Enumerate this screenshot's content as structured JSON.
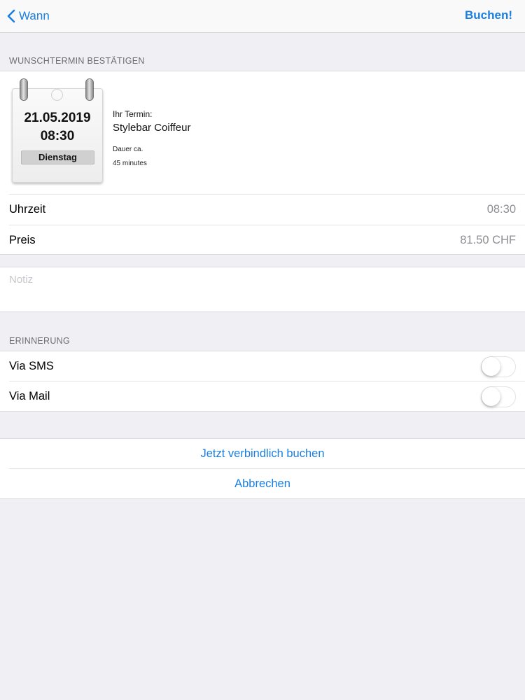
{
  "navbar": {
    "back_label": "Wann",
    "action_label": "Buchen!"
  },
  "confirm_section": {
    "header": "WUNSCHTERMIN BESTÄTIGEN",
    "calendar": {
      "date": "21.05.2019",
      "time": "08:30",
      "weekday": "Dienstag"
    },
    "appointment_label": "Ihr Termin:",
    "salon_name": "Stylebar Coiffeur",
    "duration_label": "Dauer ca.",
    "duration_value": "45 minutes",
    "rows": [
      {
        "label": "Uhrzeit",
        "value": "08:30"
      },
      {
        "label": "Preis",
        "value": "81.50 CHF"
      }
    ]
  },
  "note": {
    "placeholder": "Notiz"
  },
  "reminder_section": {
    "header": "ERINNERUNG",
    "toggles": [
      {
        "label": "Via SMS",
        "on": false
      },
      {
        "label": "Via Mail",
        "on": false
      }
    ]
  },
  "actions": {
    "book_label": "Jetzt verbindlich buchen",
    "cancel_label": "Abbrechen"
  },
  "colors": {
    "accent": "#1a7fe0",
    "background": "#efeff4",
    "secondary_text": "#8e8e93"
  }
}
